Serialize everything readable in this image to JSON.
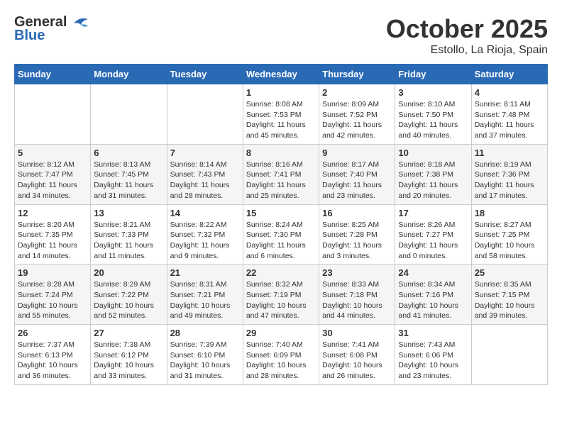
{
  "header": {
    "logo_general": "General",
    "logo_blue": "Blue",
    "month": "October 2025",
    "location": "Estollo, La Rioja, Spain"
  },
  "weekdays": [
    "Sunday",
    "Monday",
    "Tuesday",
    "Wednesday",
    "Thursday",
    "Friday",
    "Saturday"
  ],
  "weeks": [
    [
      {
        "day": "",
        "info": ""
      },
      {
        "day": "",
        "info": ""
      },
      {
        "day": "",
        "info": ""
      },
      {
        "day": "1",
        "info": "Sunrise: 8:08 AM\nSunset: 7:53 PM\nDaylight: 11 hours and 45 minutes."
      },
      {
        "day": "2",
        "info": "Sunrise: 8:09 AM\nSunset: 7:52 PM\nDaylight: 11 hours and 42 minutes."
      },
      {
        "day": "3",
        "info": "Sunrise: 8:10 AM\nSunset: 7:50 PM\nDaylight: 11 hours and 40 minutes."
      },
      {
        "day": "4",
        "info": "Sunrise: 8:11 AM\nSunset: 7:48 PM\nDaylight: 11 hours and 37 minutes."
      }
    ],
    [
      {
        "day": "5",
        "info": "Sunrise: 8:12 AM\nSunset: 7:47 PM\nDaylight: 11 hours and 34 minutes."
      },
      {
        "day": "6",
        "info": "Sunrise: 8:13 AM\nSunset: 7:45 PM\nDaylight: 11 hours and 31 minutes."
      },
      {
        "day": "7",
        "info": "Sunrise: 8:14 AM\nSunset: 7:43 PM\nDaylight: 11 hours and 28 minutes."
      },
      {
        "day": "8",
        "info": "Sunrise: 8:16 AM\nSunset: 7:41 PM\nDaylight: 11 hours and 25 minutes."
      },
      {
        "day": "9",
        "info": "Sunrise: 8:17 AM\nSunset: 7:40 PM\nDaylight: 11 hours and 23 minutes."
      },
      {
        "day": "10",
        "info": "Sunrise: 8:18 AM\nSunset: 7:38 PM\nDaylight: 11 hours and 20 minutes."
      },
      {
        "day": "11",
        "info": "Sunrise: 8:19 AM\nSunset: 7:36 PM\nDaylight: 11 hours and 17 minutes."
      }
    ],
    [
      {
        "day": "12",
        "info": "Sunrise: 8:20 AM\nSunset: 7:35 PM\nDaylight: 11 hours and 14 minutes."
      },
      {
        "day": "13",
        "info": "Sunrise: 8:21 AM\nSunset: 7:33 PM\nDaylight: 11 hours and 11 minutes."
      },
      {
        "day": "14",
        "info": "Sunrise: 8:22 AM\nSunset: 7:32 PM\nDaylight: 11 hours and 9 minutes."
      },
      {
        "day": "15",
        "info": "Sunrise: 8:24 AM\nSunset: 7:30 PM\nDaylight: 11 hours and 6 minutes."
      },
      {
        "day": "16",
        "info": "Sunrise: 8:25 AM\nSunset: 7:28 PM\nDaylight: 11 hours and 3 minutes."
      },
      {
        "day": "17",
        "info": "Sunrise: 8:26 AM\nSunset: 7:27 PM\nDaylight: 11 hours and 0 minutes."
      },
      {
        "day": "18",
        "info": "Sunrise: 8:27 AM\nSunset: 7:25 PM\nDaylight: 10 hours and 58 minutes."
      }
    ],
    [
      {
        "day": "19",
        "info": "Sunrise: 8:28 AM\nSunset: 7:24 PM\nDaylight: 10 hours and 55 minutes."
      },
      {
        "day": "20",
        "info": "Sunrise: 8:29 AM\nSunset: 7:22 PM\nDaylight: 10 hours and 52 minutes."
      },
      {
        "day": "21",
        "info": "Sunrise: 8:31 AM\nSunset: 7:21 PM\nDaylight: 10 hours and 49 minutes."
      },
      {
        "day": "22",
        "info": "Sunrise: 8:32 AM\nSunset: 7:19 PM\nDaylight: 10 hours and 47 minutes."
      },
      {
        "day": "23",
        "info": "Sunrise: 8:33 AM\nSunset: 7:18 PM\nDaylight: 10 hours and 44 minutes."
      },
      {
        "day": "24",
        "info": "Sunrise: 8:34 AM\nSunset: 7:16 PM\nDaylight: 10 hours and 41 minutes."
      },
      {
        "day": "25",
        "info": "Sunrise: 8:35 AM\nSunset: 7:15 PM\nDaylight: 10 hours and 39 minutes."
      }
    ],
    [
      {
        "day": "26",
        "info": "Sunrise: 7:37 AM\nSunset: 6:13 PM\nDaylight: 10 hours and 36 minutes."
      },
      {
        "day": "27",
        "info": "Sunrise: 7:38 AM\nSunset: 6:12 PM\nDaylight: 10 hours and 33 minutes."
      },
      {
        "day": "28",
        "info": "Sunrise: 7:39 AM\nSunset: 6:10 PM\nDaylight: 10 hours and 31 minutes."
      },
      {
        "day": "29",
        "info": "Sunrise: 7:40 AM\nSunset: 6:09 PM\nDaylight: 10 hours and 28 minutes."
      },
      {
        "day": "30",
        "info": "Sunrise: 7:41 AM\nSunset: 6:08 PM\nDaylight: 10 hours and 26 minutes."
      },
      {
        "day": "31",
        "info": "Sunrise: 7:43 AM\nSunset: 6:06 PM\nDaylight: 10 hours and 23 minutes."
      },
      {
        "day": "",
        "info": ""
      }
    ]
  ]
}
